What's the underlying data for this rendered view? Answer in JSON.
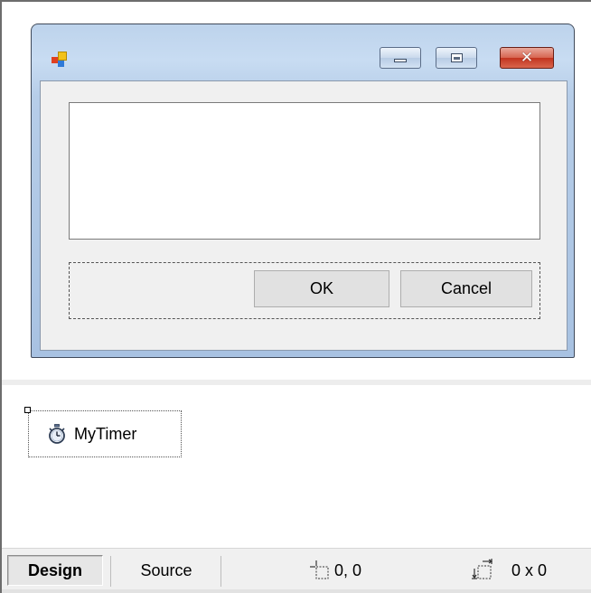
{
  "form": {
    "buttons": {
      "ok_label": "OK",
      "cancel_label": "Cancel"
    },
    "caption": {
      "close_glyph": "✕"
    }
  },
  "tray": {
    "component_label": "MyTimer",
    "component_icon": "stopwatch-icon"
  },
  "status": {
    "design_tab": "Design",
    "source_tab": "Source",
    "position": "0, 0",
    "size": "0 x 0"
  },
  "colors": {
    "close_button": "#c2341f",
    "title_bar": "#bdd3ec",
    "client_area": "#f0f0f0"
  }
}
